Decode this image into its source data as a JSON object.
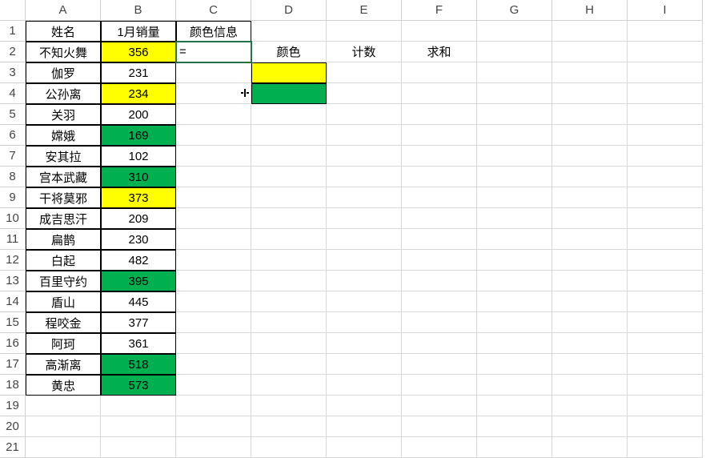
{
  "columns": [
    "A",
    "B",
    "C",
    "D",
    "E",
    "F",
    "G",
    "H",
    "I"
  ],
  "row_count": 21,
  "headers_row1": {
    "A": "姓名",
    "B": "1月销量",
    "C": "颜色信息"
  },
  "c2_value": "=",
  "side_headers_row2": {
    "D": "颜色",
    "E": "计数",
    "F": "求和"
  },
  "data_rows": [
    {
      "name": "不知火舞",
      "val": "356",
      "fill": "yellow"
    },
    {
      "name": "伽罗",
      "val": "231",
      "fill": ""
    },
    {
      "name": "公孙离",
      "val": "234",
      "fill": "yellow"
    },
    {
      "name": "关羽",
      "val": "200",
      "fill": ""
    },
    {
      "name": "嫦娥",
      "val": "169",
      "fill": "green"
    },
    {
      "name": "安其拉",
      "val": "102",
      "fill": ""
    },
    {
      "name": "宫本武藏",
      "val": "310",
      "fill": "green"
    },
    {
      "name": "干将莫邪",
      "val": "373",
      "fill": "yellow"
    },
    {
      "name": "成吉思汗",
      "val": "209",
      "fill": ""
    },
    {
      "name": "扁鹊",
      "val": "230",
      "fill": ""
    },
    {
      "name": "白起",
      "val": "482",
      "fill": ""
    },
    {
      "name": "百里守约",
      "val": "395",
      "fill": "green"
    },
    {
      "name": "盾山",
      "val": "445",
      "fill": ""
    },
    {
      "name": "程咬金",
      "val": "377",
      "fill": ""
    },
    {
      "name": "阿珂",
      "val": "361",
      "fill": ""
    },
    {
      "name": "高渐离",
      "val": "518",
      "fill": "green"
    },
    {
      "name": "黄忠",
      "val": "573",
      "fill": "green"
    }
  ],
  "d3_fill": "yellow",
  "d4_fill": "green",
  "chart_data": {
    "type": "table",
    "title": "1月销量",
    "columns": [
      "姓名",
      "1月销量"
    ],
    "rows": [
      [
        "不知火舞",
        356
      ],
      [
        "伽罗",
        231
      ],
      [
        "公孙离",
        234
      ],
      [
        "关羽",
        200
      ],
      [
        "嫦娥",
        169
      ],
      [
        "安其拉",
        102
      ],
      [
        "宫本武藏",
        310
      ],
      [
        "干将莫邪",
        373
      ],
      [
        "成吉思汗",
        209
      ],
      [
        "扁鹊",
        230
      ],
      [
        "白起",
        482
      ],
      [
        "百里守约",
        395
      ],
      [
        "盾山",
        445
      ],
      [
        "程咬金",
        377
      ],
      [
        "阿珂",
        361
      ],
      [
        "高渐离",
        518
      ],
      [
        "黄忠",
        573
      ]
    ]
  }
}
